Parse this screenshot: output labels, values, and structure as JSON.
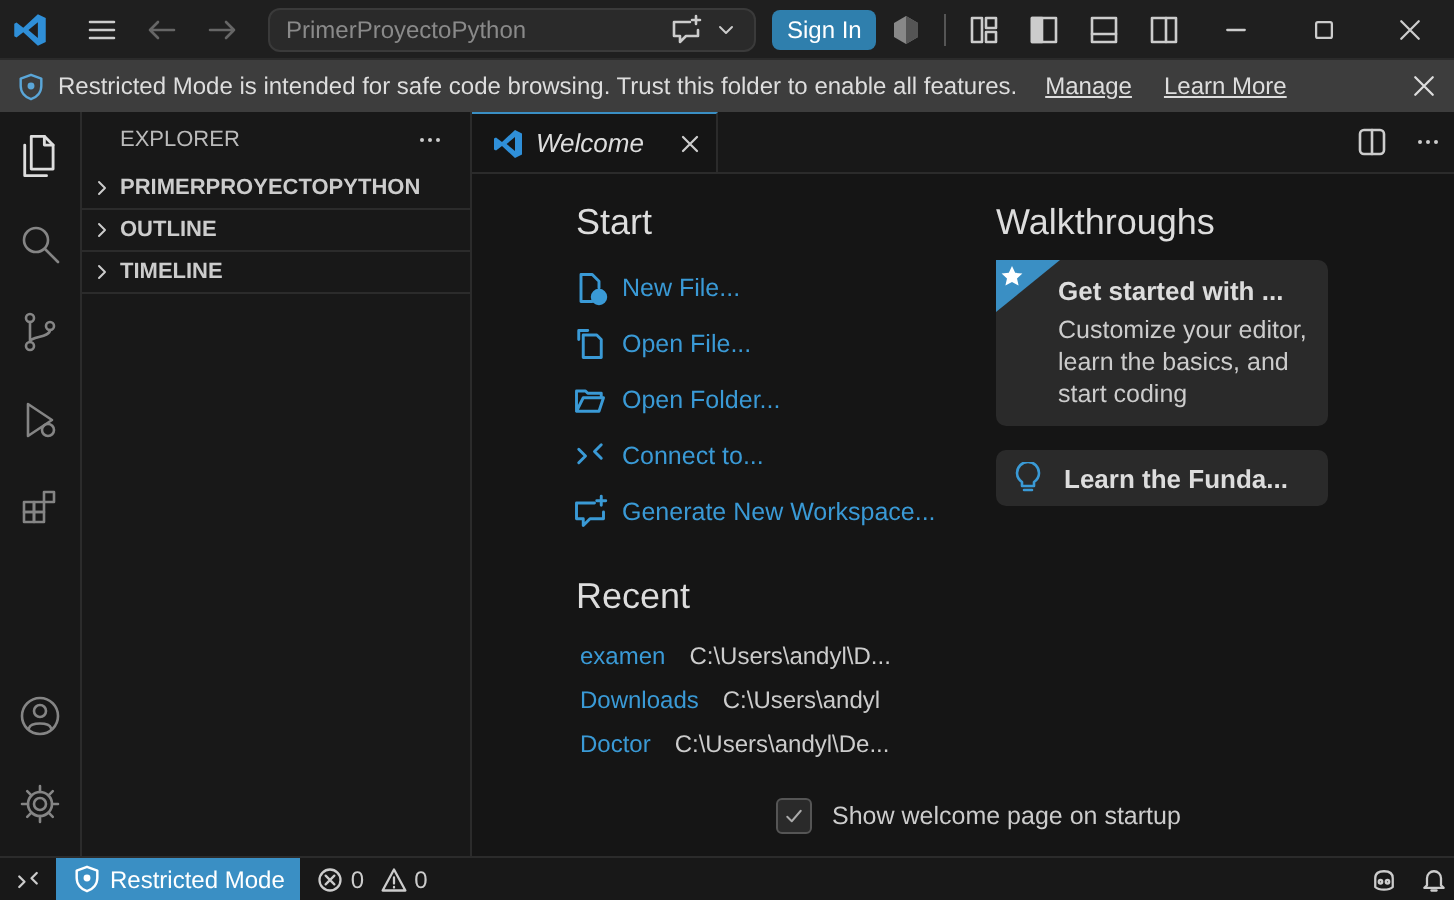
{
  "title_bar": {
    "search_text": "PrimerProyectoPython",
    "sign_in": "Sign In"
  },
  "banner": {
    "message": "Restricted Mode is intended for safe code browsing. Trust this folder to enable all features.",
    "links": [
      "Manage",
      "Learn More"
    ]
  },
  "activity_bar": {
    "top": [
      {
        "kind": "files",
        "selected": true
      },
      {
        "kind": "search",
        "selected": false
      },
      {
        "kind": "source-control",
        "selected": false
      },
      {
        "kind": "run",
        "selected": false
      },
      {
        "kind": "extensions",
        "selected": false
      }
    ],
    "bottom": [
      {
        "kind": "account"
      },
      {
        "kind": "settings"
      }
    ]
  },
  "sidebar": {
    "title": "EXPLORER",
    "sections": [
      {
        "label": "PRIMERPROYECTOPYTHON",
        "expanded": false
      },
      {
        "label": "OUTLINE",
        "expanded": false
      },
      {
        "label": "TIMELINE",
        "expanded": false
      }
    ]
  },
  "tabs": [
    {
      "label": "Welcome",
      "selected": true
    }
  ],
  "start": {
    "heading": "Start",
    "actions": [
      {
        "kind": "new-file",
        "label": "New File..."
      },
      {
        "kind": "open-file",
        "label": "Open File..."
      },
      {
        "kind": "open-folder",
        "label": "Open Folder..."
      },
      {
        "kind": "connect",
        "label": "Connect to..."
      },
      {
        "kind": "generate",
        "label": "Generate New Workspace..."
      }
    ]
  },
  "recent": {
    "heading": "Recent",
    "items": [
      {
        "name": "examen",
        "path": "C:\\Users\\andyl\\D..."
      },
      {
        "name": "Downloads",
        "path": "C:\\Users\\andyl"
      },
      {
        "name": "Doctor",
        "path": "C:\\Users\\andyl\\De..."
      }
    ]
  },
  "walkthroughs": {
    "heading": "Walkthroughs",
    "cards": [
      {
        "kind": "featured",
        "title": "Get started with ...",
        "description": "Customize your editor, learn the basics, and start coding"
      },
      {
        "kind": "bulb",
        "title": "Learn the Funda..."
      }
    ]
  },
  "show_on_startup": {
    "label": "Show welcome page on startup",
    "checked": true
  },
  "status_bar": {
    "mode": "Restricted Mode",
    "errors": "0",
    "warnings": "0"
  }
}
